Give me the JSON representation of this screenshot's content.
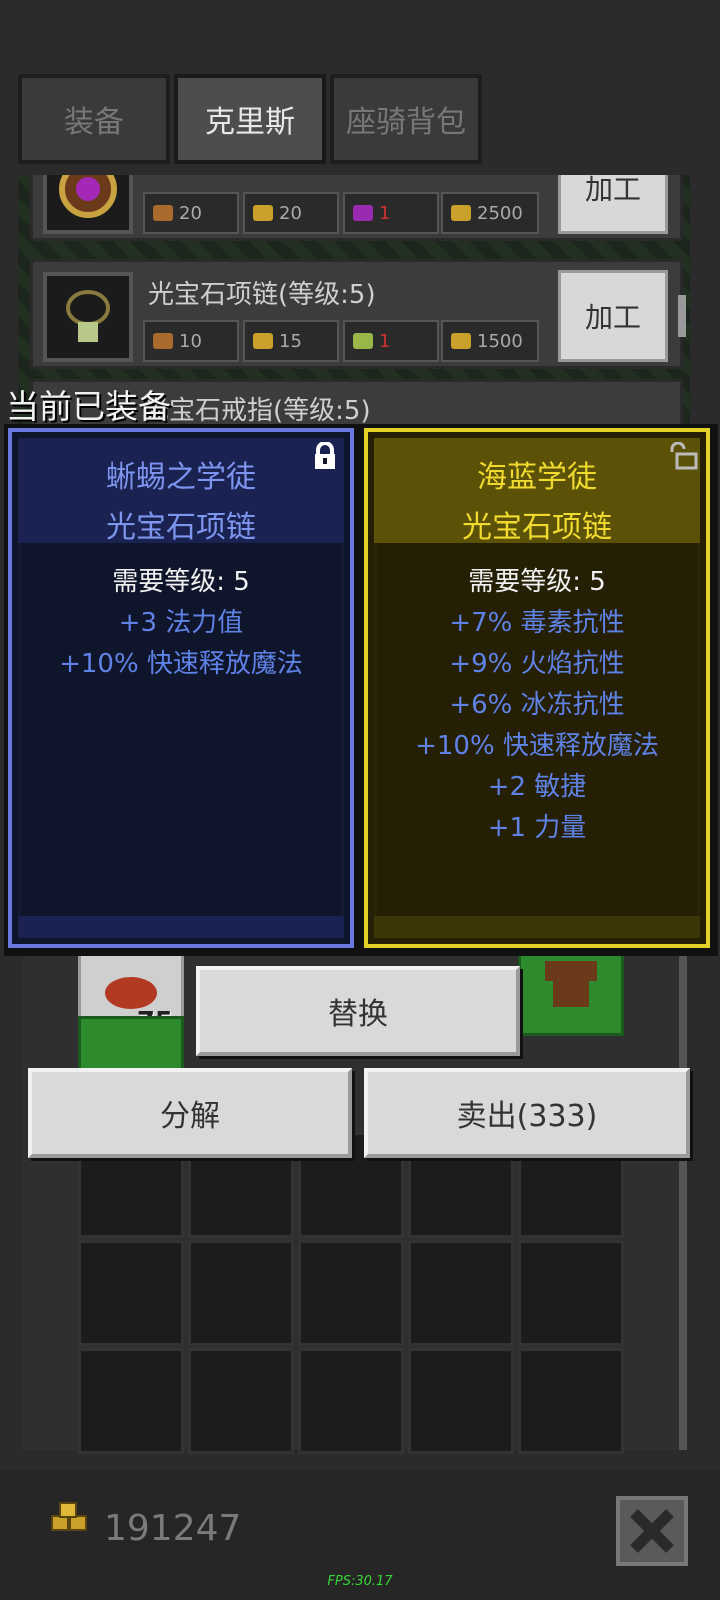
{
  "tabs": [
    {
      "label": "装备",
      "active": false
    },
    {
      "label": "克里斯",
      "active": true
    },
    {
      "label": "座骑背包",
      "active": false
    }
  ],
  "craft": {
    "rows": [
      {
        "name": "",
        "costs": [
          "20",
          "20",
          "1",
          "2500"
        ],
        "button": "加工"
      },
      {
        "name": "光宝石项链(等级:5)",
        "costs": [
          "10",
          "15",
          "1",
          "1500"
        ],
        "button": "加工"
      },
      {
        "name": "光宝石戒指(等级:5)",
        "costs": [],
        "button": ""
      }
    ]
  },
  "equipped_title": "当前已装备",
  "compare": {
    "equipped": {
      "title1": "蜥蜴之学徒",
      "title2": "光宝石项链",
      "requirement": "需要等级: 5",
      "stats": [
        "+3 法力值",
        "+10% 快速释放魔法"
      ],
      "locked": true,
      "rarity_color": "#6a78e0"
    },
    "candidate": {
      "title1": "海蓝学徒",
      "title2": "光宝石项链",
      "requirement": "需要等级: 5",
      "stats": [
        "+7% 毒素抗性",
        "+9% 火焰抗性",
        "+6% 冰冻抗性",
        "+10% 快速释放魔法",
        "+2 敏捷",
        "+1 力量"
      ],
      "locked": false,
      "rarity_color": "#e5d229"
    }
  },
  "inventory": {
    "first_slot_qty": "75"
  },
  "buttons": {
    "replace": "替换",
    "decompose": "分解",
    "sell": "卖出(333)"
  },
  "gold": "191247",
  "fps": "FPS:30.17",
  "icons": {
    "close": "close-icon",
    "gold": "gold-coins-icon",
    "lock": "lock-icon",
    "unlock": "unlock-icon"
  }
}
